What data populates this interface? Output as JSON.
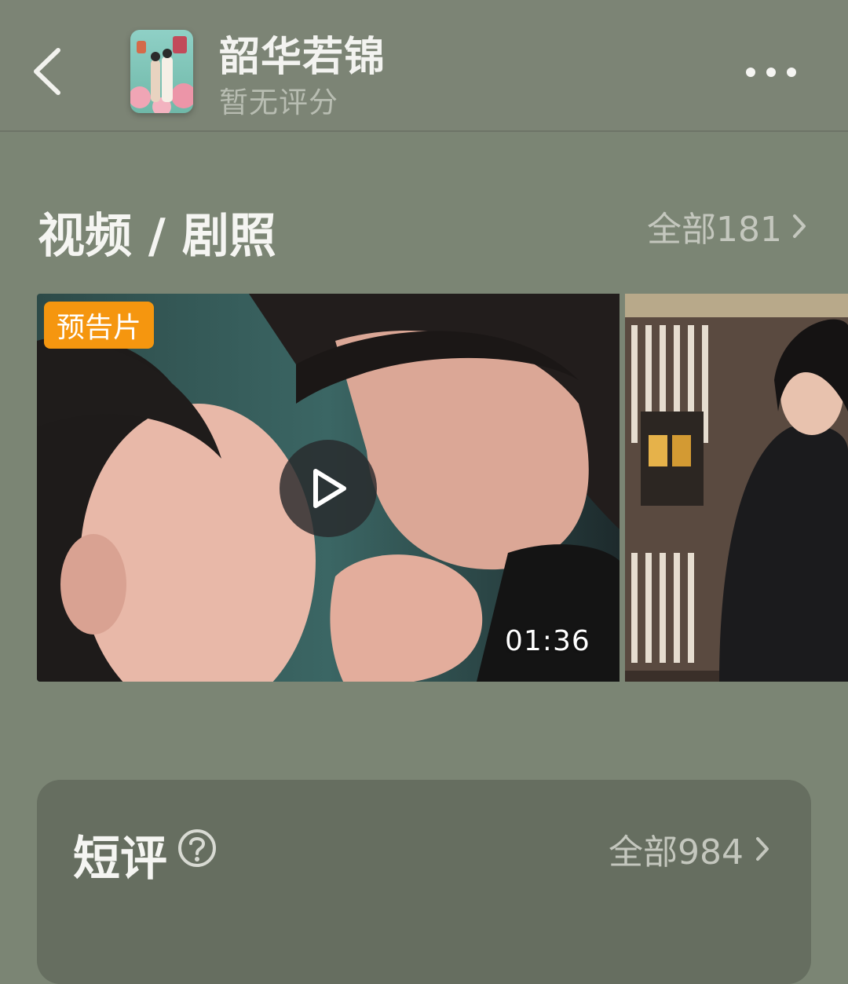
{
  "header": {
    "title": "韶华若锦",
    "subtitle": "暂无评分"
  },
  "media": {
    "section_title": "视频 / 剧照",
    "see_all_label": "全部181",
    "video": {
      "badge": "预告片",
      "duration": "01:36"
    }
  },
  "reviews": {
    "section_title": "短评",
    "see_all_label": "全部984"
  },
  "icons": {
    "back": "chevron-left-icon",
    "more": "more-horizontal-icon",
    "play": "play-icon",
    "help": "question-circle-icon",
    "chevron": "chevron-right-icon"
  },
  "colors": {
    "background": "#7b8574",
    "card": "#666e60",
    "badge": "#f5960f"
  }
}
